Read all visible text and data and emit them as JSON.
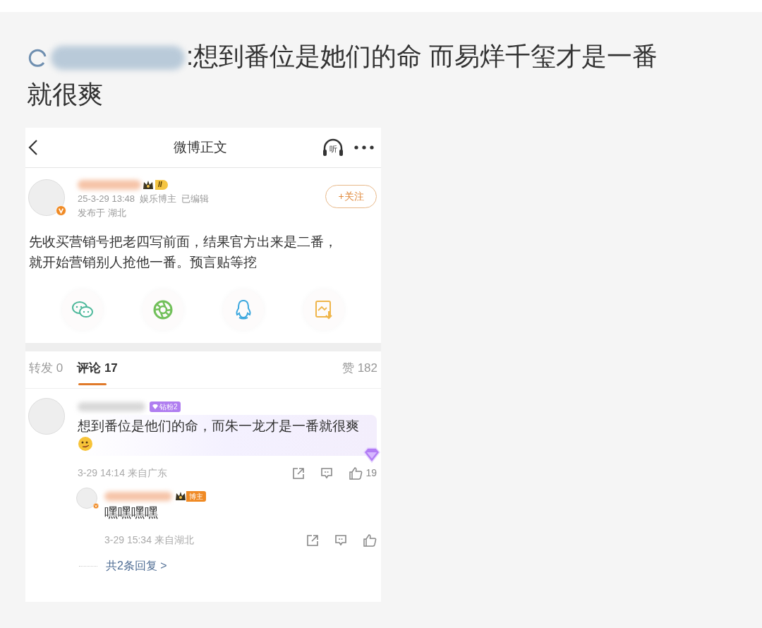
{
  "headline": {
    "lines": [
      ":想到番位是她们的命 而易烊千玺才是一番",
      "就很爽"
    ]
  },
  "screenshot": {
    "nav": {
      "title": "微博正文",
      "listen_label": "听"
    },
    "post": {
      "level_badge": "II",
      "meta": "25-3-29 13:48  娱乐博主  已编辑",
      "location": "发布于 湖北",
      "follow": "+关注",
      "verified": true,
      "text": "先收买营销号把老四写前面，结果官方出来是二番，就开始营销别人抢他一番。预言贴等挖",
      "share": [
        {
          "kind": "wechat"
        },
        {
          "kind": "moments"
        },
        {
          "kind": "qq"
        },
        {
          "kind": "save"
        }
      ]
    },
    "tabs": [
      {
        "label": "转发 0",
        "selected": false
      },
      {
        "label": "评论 17",
        "selected": true
      }
    ],
    "likes": "赞 182",
    "comments": [
      {
        "badge": {
          "kind": "fan",
          "text": "钻粉2"
        },
        "text": "想到番位是他们的命，而朱一龙才是一番就很爽",
        "emoji": true,
        "meta": "3-29 14:14 来自广东",
        "like_count": "19",
        "verified": false,
        "children": [
          {
            "badge": {
              "kind": "author",
              "text": "博主"
            },
            "text": "嘿嘿嘿嘿",
            "emoji": false,
            "meta": "3-29 15:34 来自湖北",
            "verified": true
          }
        ]
      }
    ],
    "more_replies": "共2条回复 >"
  }
}
